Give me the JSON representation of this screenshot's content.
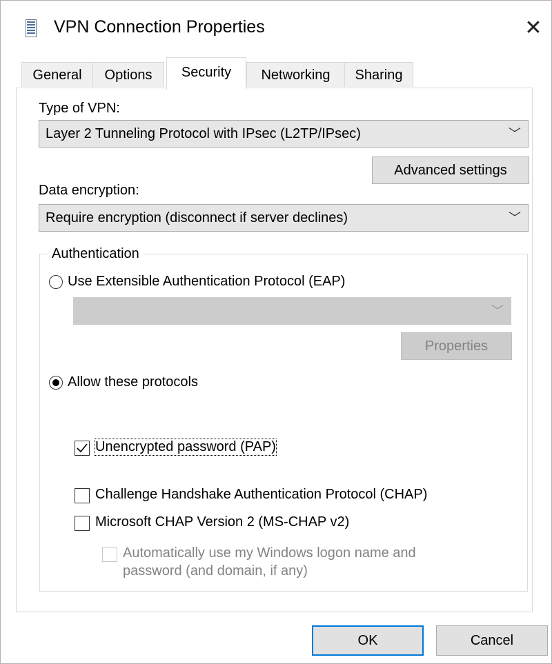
{
  "window": {
    "title": "VPN Connection Properties",
    "close_glyph": "✕"
  },
  "tabs": [
    {
      "label": "General",
      "active": false
    },
    {
      "label": "Options",
      "active": false
    },
    {
      "label": "Security",
      "active": true
    },
    {
      "label": "Networking",
      "active": false
    },
    {
      "label": "Sharing",
      "active": false
    }
  ],
  "security": {
    "type_of_vpn": {
      "label": "Type of VPN:",
      "value": "Layer 2 Tunneling Protocol with IPsec (L2TP/IPsec)"
    },
    "advanced_settings_label": "Advanced settings",
    "data_encryption": {
      "label": "Data encryption:",
      "value": "Require encryption (disconnect if server declines)"
    },
    "authentication": {
      "legend": "Authentication",
      "eap_radio": {
        "label": "Use Extensible Authentication Protocol (EAP)",
        "selected": false
      },
      "eap_combo_value": "",
      "properties_label": "Properties",
      "allow_radio": {
        "label": "Allow these protocols",
        "selected": true
      },
      "protocols": [
        {
          "label": "Unencrypted password (PAP)",
          "checked": true
        },
        {
          "label": "Challenge Handshake Authentication Protocol (CHAP)",
          "checked": false
        },
        {
          "label": "Microsoft CHAP Version 2 (MS-CHAP v2)",
          "checked": false
        }
      ],
      "auto_logon": {
        "line1": "Automatically use my Windows logon name and",
        "line2": "password (and domain, if any)",
        "checked": false,
        "disabled": true
      }
    }
  },
  "buttons": {
    "ok": "OK",
    "cancel": "Cancel"
  },
  "colors": {
    "focus_blue": "#0078d7",
    "disabled_gray": "#cccccc"
  },
  "icons": {
    "title": "document-icon",
    "dropdown": "chevron-down-icon",
    "check": "checkmark-icon"
  }
}
